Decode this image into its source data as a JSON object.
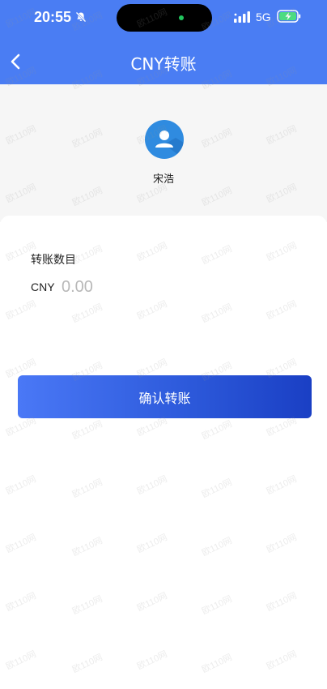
{
  "status_bar": {
    "time": "20:55",
    "network": "5G"
  },
  "nav": {
    "title": "CNY转账"
  },
  "recipient": {
    "name": "宋浩"
  },
  "form": {
    "amount_label": "转账数目",
    "currency": "CNY",
    "amount_placeholder": "0.00",
    "amount_value": ""
  },
  "actions": {
    "confirm_label": "确认转账"
  },
  "watermark": {
    "text": "欧110网"
  },
  "colors": {
    "header": "#4a7df3",
    "button_start": "#4a78f6",
    "button_end": "#1a3fc4",
    "avatar": "#2f8be0"
  },
  "icons": {
    "back": "chevron-left-icon",
    "bell": "bell-muted-icon",
    "signal": "signal-icon",
    "battery": "battery-charging-icon",
    "avatar": "user-icon"
  }
}
